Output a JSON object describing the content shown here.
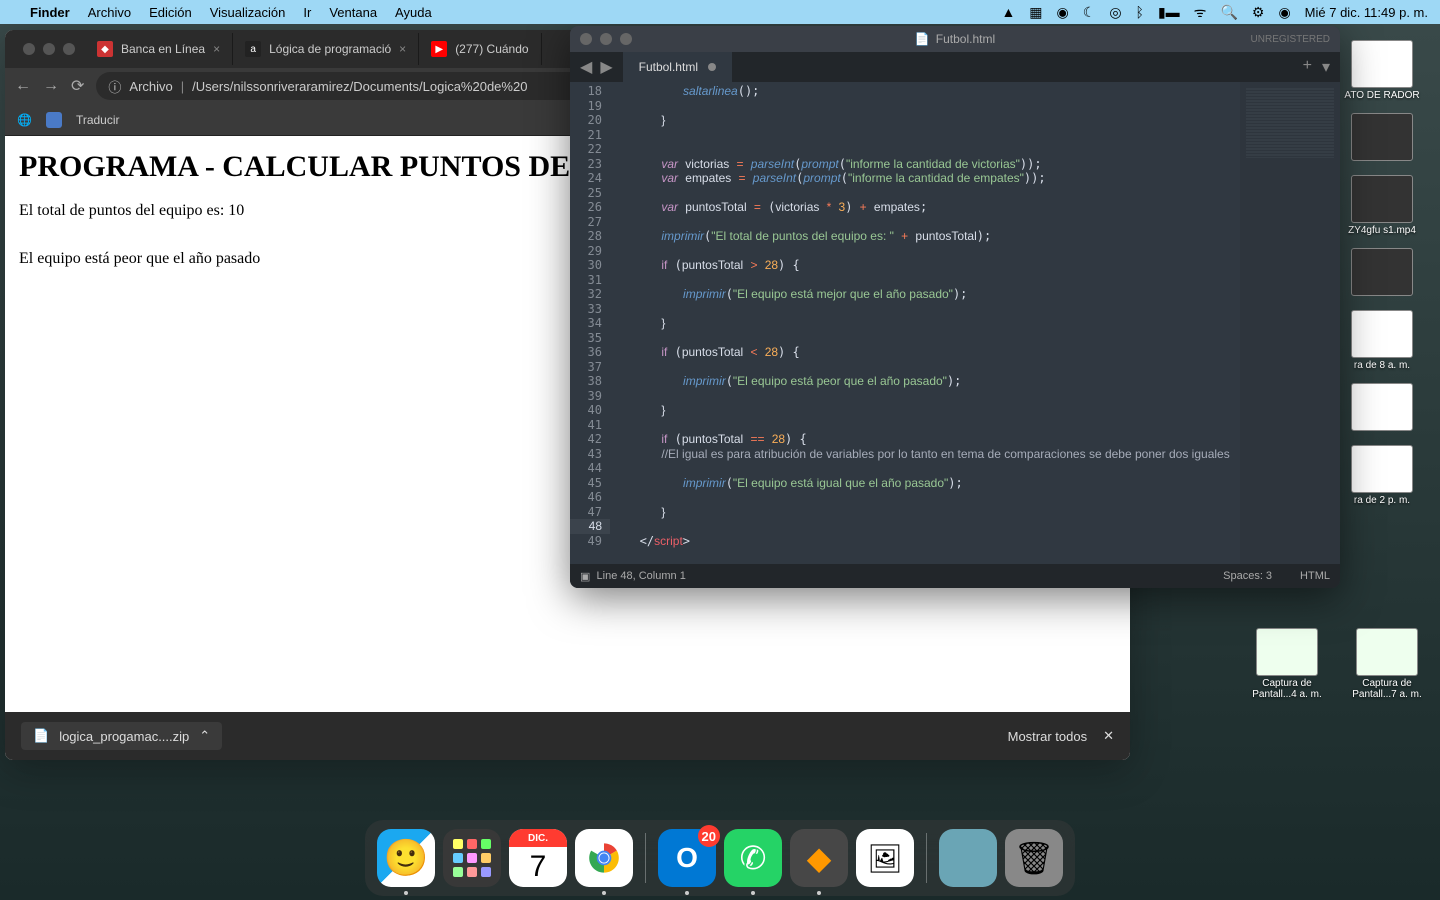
{
  "menubar": {
    "app": "Finder",
    "items": [
      "Archivo",
      "Edición",
      "Visualización",
      "Ir",
      "Ventana",
      "Ayuda"
    ],
    "clock": "Mié 7 dic.  11:49 p. m."
  },
  "browser": {
    "tabs": [
      {
        "label": "Banca en Línea"
      },
      {
        "label": "Lógica de programació"
      },
      {
        "label": "(277) Cuándo"
      }
    ],
    "url_prefix": "Archivo",
    "url": "/Users/nilssonriveraramirez/Documents/Logica%20de%20",
    "bookmark": "Traducir",
    "page": {
      "heading": "PROGRAMA - CALCULAR PUNTOS DE",
      "line1": "El total de puntos del equipo es: 10",
      "line2": "El equipo está peor que el año pasado"
    },
    "download": {
      "file": "logica_progamac....zip",
      "showall": "Mostrar todos"
    }
  },
  "sublime": {
    "title": "Futbol.html",
    "unregistered": "UNREGISTERED",
    "tab": "Futbol.html",
    "status": {
      "pos": "Line 48, Column 1",
      "spaces": "Spaces: 3",
      "lang": "HTML"
    },
    "lines": {
      "start": 18,
      "end": 49,
      "highlight": 48
    },
    "code": {
      "l18_fn": "saltarlinea",
      "l23_s": "\"informe la cantidad de victorias\"",
      "l24_s": "\"informe la cantidad de empates\"",
      "l28_s": "\"El total de puntos del equipo es: \"",
      "l32_s": "\"El equipo está mejor que el año pasado\"",
      "l38_s": "\"El equipo está peor que el año pasado\"",
      "l43_c": "//El igual es para atribución de variables por lo tanto en tema de comparaciones se debe poner dos iguales",
      "l45_s": "\"El equipo está igual que el año pasado\"",
      "kw_var": "var",
      "kw_if": "if",
      "id_vict": "victorias",
      "id_emp": "empates",
      "id_pt": "puntosTotal",
      "fn_pi": "parseInt",
      "fn_pr": "prompt",
      "fn_imp": "imprimir",
      "n3": "3",
      "n28": "28",
      "tag_script": "script"
    }
  },
  "desktop": {
    "files": [
      {
        "label": "ATO DE\nRADOR"
      },
      {
        "label": ""
      },
      {
        "label": "ZY4gfu\ns1.mp4"
      },
      {
        "label": ""
      },
      {
        "label": "ra de\n8 a. m."
      },
      {
        "label": ""
      },
      {
        "label": "ra de\n2 p. m."
      }
    ],
    "row": [
      {
        "label": "Captura de\nPantall...4 a. m."
      },
      {
        "label": "Captura de\nPantall...7 a. m."
      }
    ]
  },
  "dock": {
    "cal_month": "DIC.",
    "cal_day": "7",
    "badge": "20"
  }
}
